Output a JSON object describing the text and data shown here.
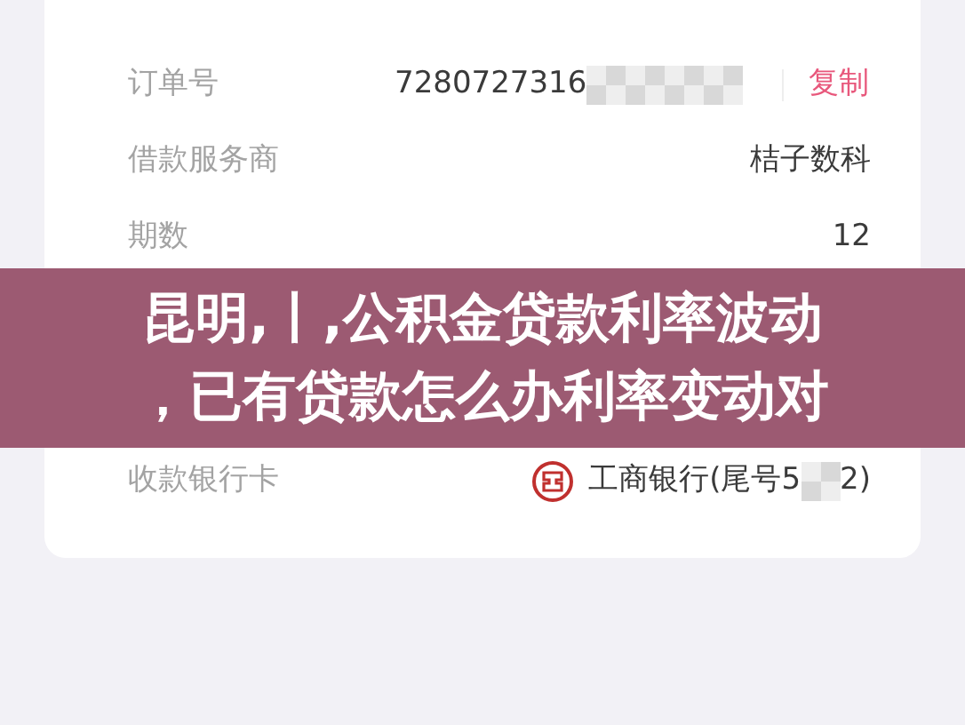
{
  "details": {
    "rows": [
      {
        "kind": "order",
        "label": "订单号",
        "value": "7280727316",
        "action": "复制"
      },
      {
        "kind": "plain",
        "label": "借款服务商",
        "value": "桔子数科"
      },
      {
        "kind": "plain",
        "label": "期数",
        "value": "12"
      },
      {
        "kind": "hidden"
      },
      {
        "kind": "hidden"
      },
      {
        "kind": "bank",
        "label": "收款银行卡",
        "value": "工商银行(尾号5",
        "value_end": "2)"
      }
    ]
  },
  "banner": {
    "lines": [
      "昆明,丨,公积金贷款利率波动",
      "，已有贷款怎么办利率变动对"
    ]
  }
}
